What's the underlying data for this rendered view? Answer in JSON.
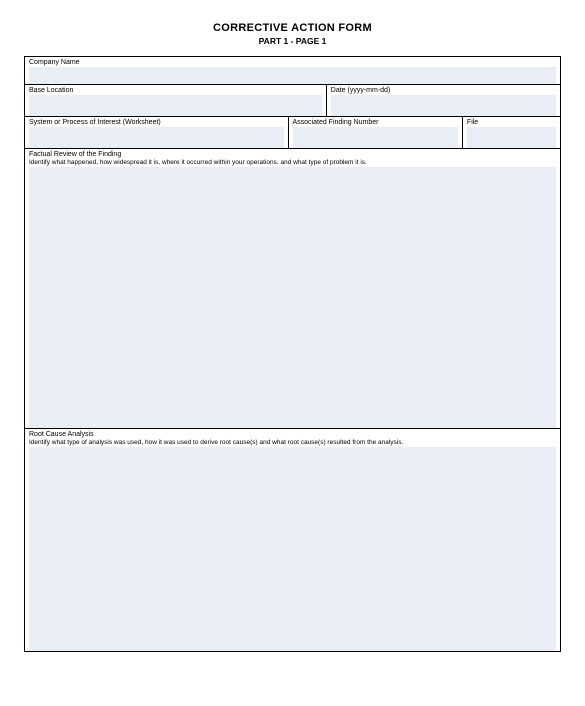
{
  "header": {
    "title": "CORRECTIVE ACTION FORM",
    "subtitle": "PART 1 - PAGE 1"
  },
  "fields": {
    "company_name": {
      "label": "Company Name"
    },
    "base_location": {
      "label": "Base Location"
    },
    "date": {
      "label": "Date (yyyy-mm-dd)"
    },
    "system_process": {
      "label": "System or Process of Interest (Worksheet)"
    },
    "finding_number": {
      "label": "Associated Finding Number"
    },
    "file": {
      "label": "File"
    },
    "factual_review": {
      "label": "Factual Review of the Finding",
      "sublabel": "Identify what happened, how widespread it is, where it occurred within your operations, and what type of problem it is."
    },
    "root_cause": {
      "label": "Root Cause Analysis",
      "sublabel": "Identify what type of analysis was used, how it was used to derive root cause(s) and what root cause(s) resulted from the analysis."
    }
  }
}
